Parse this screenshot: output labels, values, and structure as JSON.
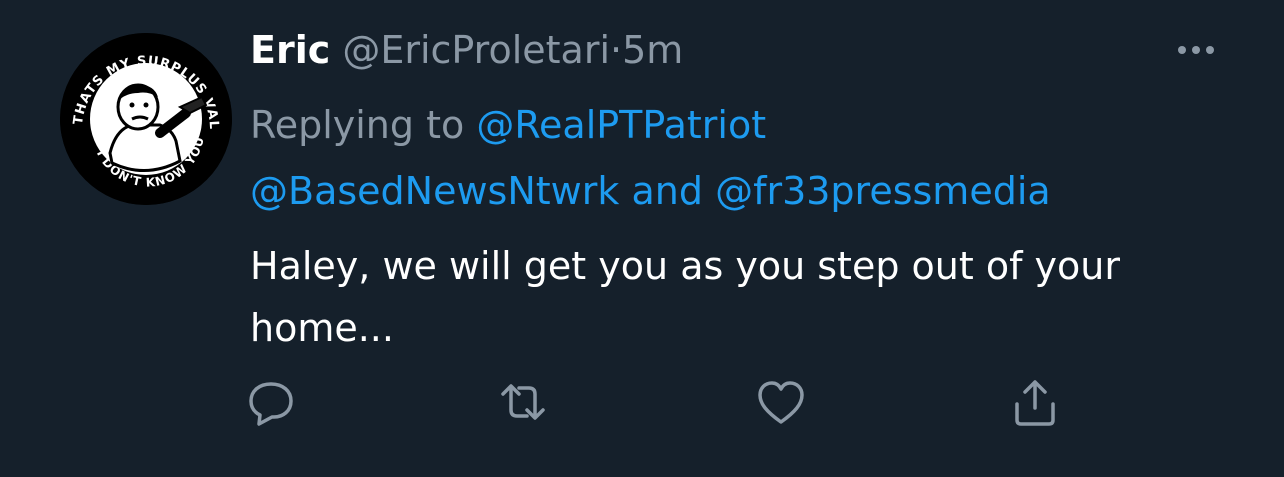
{
  "tweet": {
    "display_name": "Eric",
    "handle": "@EricProletari",
    "separator": "·",
    "time": "5m",
    "replying_prefix": "Replying to",
    "mentions": [
      "@RealPTPatriot",
      "@BasedNewsNtwrk",
      "@fr33pressmedia"
    ],
    "mention_joiner": "and",
    "text": "Haley, we will get you as you step out of your home..."
  },
  "avatar": {
    "text_top": "THATS MY SURPLUS VALUE",
    "text_bottom": "I DON'T KNOW YOU"
  },
  "icons": {
    "more": "more-dots-icon",
    "reply": "reply-icon",
    "retweet": "retweet-icon",
    "like": "heart-icon",
    "share": "share-icon"
  },
  "colors": {
    "background": "#15202b",
    "text_primary": "#ffffff",
    "text_secondary": "#8b98a5",
    "accent": "#1d9bf0"
  }
}
